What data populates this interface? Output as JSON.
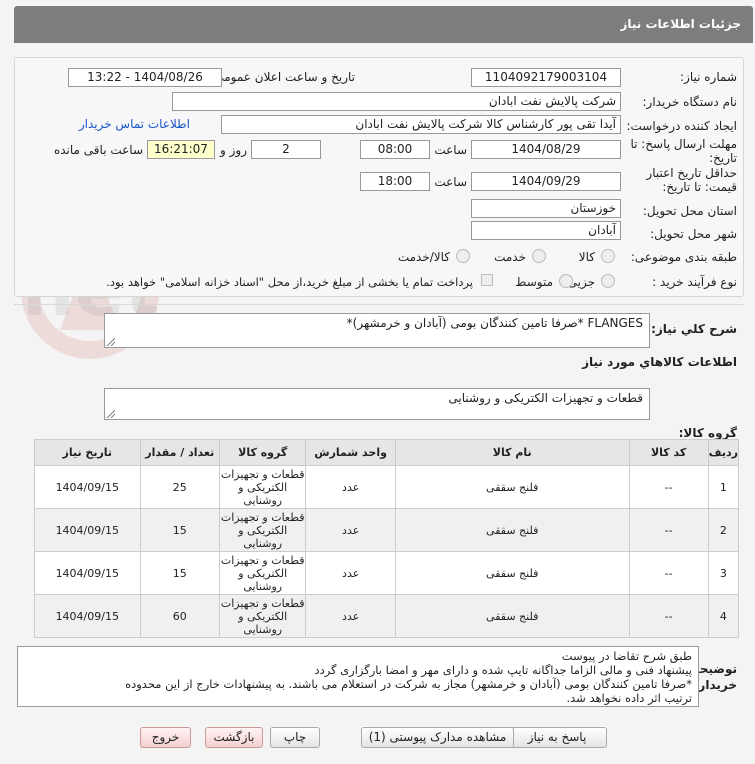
{
  "header": {
    "title": "جزئیات اطلاعات نیاز"
  },
  "form": {
    "need_number_label": "شماره نیاز:",
    "need_number": "1104092179003104",
    "announce_label": "تاریخ و ساعت اعلان عمومی:",
    "announce_value": "1404/08/26 - 13:22",
    "buyer_org_label": "نام دستگاه خریدار:",
    "buyer_org": "شرکت پالایش نفت ابادان",
    "creator_label": "ایجاد کننده درخواست:",
    "creator": "آیدا تقی پور کارشناس کالا شرکت پالایش نفت ابادان",
    "contact_link": "اطلاعات تماس خریدار",
    "deadline_label_1": "مهلت ارسال پاسخ: تا",
    "deadline_label_2": "تاریخ:",
    "deadline_date": "1404/08/29",
    "time_label": "ساعت",
    "deadline_time": "08:00",
    "days_value": "2",
    "days_label": "روز و",
    "remaining_time": "16:21:07",
    "remaining_label": "ساعت باقی مانده",
    "validity_label_1": "حداقل تاریخ اعتبار",
    "validity_label_2": "قیمت: تا تاریخ:",
    "validity_date": "1404/09/29",
    "validity_time": "18:00",
    "province_label": "استان محل تحویل:",
    "province": "خوزستان",
    "city_label": "شهر محل تحویل:",
    "city": "آبادان",
    "category_label": "طبقه بندی موضوعی:",
    "category_options": [
      "کالا",
      "خدمت",
      "کالا/خدمت"
    ],
    "process_label": "نوع فرآیند خرید :",
    "process_options": [
      "جزیی",
      "متوسط"
    ],
    "payment_note": "پرداخت تمام یا بخشی از مبلغ خرید،از محل \"اسناد خزانه اسلامی\" خواهد بود."
  },
  "summary": {
    "label": "شرح کلي نياز:",
    "text": "FLANGES *صرفا تامین کنندگان بومی (آبادان و خرمشهر)*"
  },
  "goods_info": {
    "title": "اطلاعات کالاهاي مورد نياز",
    "group_label": "گروه کالا:",
    "group_value": "قطعات و تجهیزات الکتریکی و روشنایی"
  },
  "table": {
    "headers": [
      "ردیف",
      "کد کالا",
      "نام کالا",
      "واحد شمارش",
      "گروه کالا",
      "تعداد / مقدار",
      "تاریخ نیاز"
    ],
    "rows": [
      [
        "1",
        "--",
        "فلنج سققی",
        "عدد",
        "قطعات و تجهیزات الکتریکی و روشنایی",
        "25",
        "1404/09/15"
      ],
      [
        "2",
        "--",
        "فلنج سققی",
        "عدد",
        "قطعات و تجهیزات الکتریکی و روشنایی",
        "15",
        "1404/09/15"
      ],
      [
        "3",
        "--",
        "فلنج سققی",
        "عدد",
        "قطعات و تجهیزات الکتریکی و روشنایی",
        "15",
        "1404/09/15"
      ],
      [
        "4",
        "--",
        "فلنج سققی",
        "عدد",
        "قطعات و تجهیزات الکتریکی و روشنایی",
        "60",
        "1404/09/15"
      ]
    ]
  },
  "buyer_notes": {
    "label_1": "توضیحات",
    "label_2": "خریدار:",
    "lines": [
      "طبق شرح تقاضا در پیوست",
      "پیشنهاد فنی و مالی الزاما جداگانه تایپ شده و دارای مهر و امضا بارگزاری گردد",
      "*صرفا تامین کنندگان بومی (آبادان و خرمشهر) مجاز به شرکت در استعلام می باشند. به پیشنهادات خارج از این محدوده",
      "ترتیب اثر داده نخواهد شد."
    ]
  },
  "buttons": {
    "reply": "پاسخ به نیاز",
    "attachments": "مشاهده مدارک پیوستی (1)",
    "print": "چاپ",
    "back": "بازگشت",
    "exit": "خروج"
  },
  "watermark": {
    "text": "AriaTender.net"
  }
}
